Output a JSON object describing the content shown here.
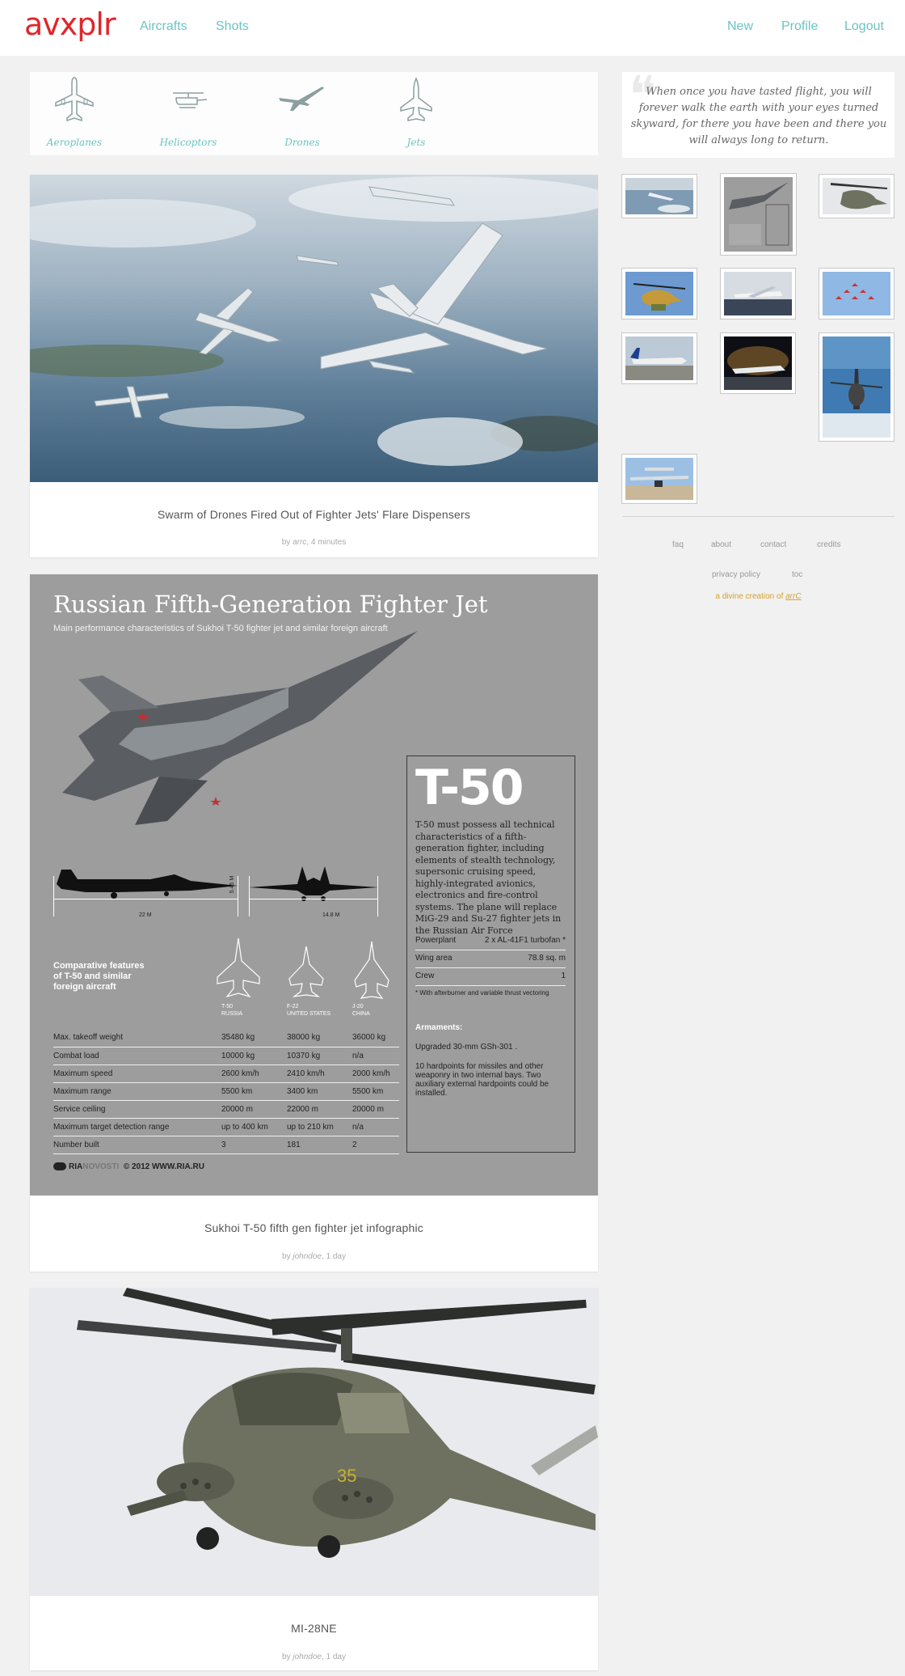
{
  "header": {
    "logo": "avxplr",
    "nav_left": [
      "Aircrafts",
      "Shots"
    ],
    "nav_right": [
      "New",
      "Profile",
      "Logout"
    ]
  },
  "categories": [
    {
      "label": "Aeroplanes",
      "icon": "airplane-icon"
    },
    {
      "label": "Helicoptors",
      "icon": "helicopter-icon"
    },
    {
      "label": "Drones",
      "icon": "drone-icon"
    },
    {
      "label": "Jets",
      "icon": "jet-icon"
    }
  ],
  "posts": [
    {
      "caption": "Swarm of Drones Fired Out of Fighter Jets' Flare Dispensers",
      "by": "by ",
      "author": "arrc",
      "time": ", 4 minutes"
    },
    {
      "caption": "Sukhoi T-50 fifth gen fighter jet infographic",
      "by": "by ",
      "author": "johndoe",
      "time": ", 1 day"
    },
    {
      "caption": "MI-28NE",
      "by": "by ",
      "author": "johndoe",
      "time": ", 1 day"
    }
  ],
  "infographic": {
    "title": "Russian Fifth-Generation Fighter Jet",
    "subtitle": "Main performance characteristics of Sukhoi T-50 fighter jet and similar foreign aircraft",
    "model": "T-50",
    "description": "T-50 must possess all technical characteristics of a fifth-generation fighter, including elements of stealth technology, supersonic cruising speed, highly-integrated avionics, electronics and fire-control systems. The plane will replace MiG-29 and Su-27 fighter jets in the Russian Air Force",
    "specs": [
      {
        "k": "Powerplant",
        "v": "2 x AL-41F1 turbofan *"
      },
      {
        "k": "Wing area",
        "v": "78.8 sq. m"
      },
      {
        "k": "Crew",
        "v": "1"
      }
    ],
    "note": "* With afterburner and variable thrust vectoring",
    "armaments_title": "Armaments:",
    "armament_1": "Upgraded 30-mm GSh-301 .",
    "armament_2": "10 hardpoints for missiles and other weaponry in two internal bays. Two auxiliary external hardpoints could be installed.",
    "comparative": "Comparative features of T-50 and similar foreign aircraft",
    "dim_length": "22 M",
    "dim_span": "14.8 M",
    "dim_height": "5.45 M",
    "aircraft": [
      {
        "name": "T-50",
        "country": "RUSSIA"
      },
      {
        "name": "F-22",
        "country": "UNITED STATES"
      },
      {
        "name": "J-20",
        "country": "CHINA"
      }
    ],
    "rows": [
      [
        "Max. takeoff weight",
        "35480 kg",
        "38000 kg",
        "36000 kg"
      ],
      [
        "Combat load",
        "10000 kg",
        "10370 kg",
        "n/a"
      ],
      [
        "Maximum speed",
        "2600 km/h",
        "2410 km/h",
        "2000 km/h"
      ],
      [
        "Maximum range",
        "5500 km",
        "3400 km",
        "5500 km"
      ],
      [
        "Service ceiling",
        "20000 m",
        "22000 m",
        "20000 m"
      ],
      [
        "Maximum target detection range",
        "up to 400 km",
        "up to 210 km",
        "n/a"
      ],
      [
        "Number built",
        "3",
        "181",
        "2"
      ]
    ],
    "brand_ria": "RIA",
    "brand_novosti": "NOVOSTI",
    "copyright": "© 2012 WWW.RIA.RU"
  },
  "quote": "When once you have tasted flight, you will forever walk the earth with your eyes turned skyward, for there you have been and there you will always long to return.",
  "footer": {
    "links": [
      "faq",
      "about",
      "contact",
      "credits",
      "privacy policy",
      "toc"
    ],
    "credit_prefix": "a divine creation of ",
    "credit_author": "arrC"
  }
}
